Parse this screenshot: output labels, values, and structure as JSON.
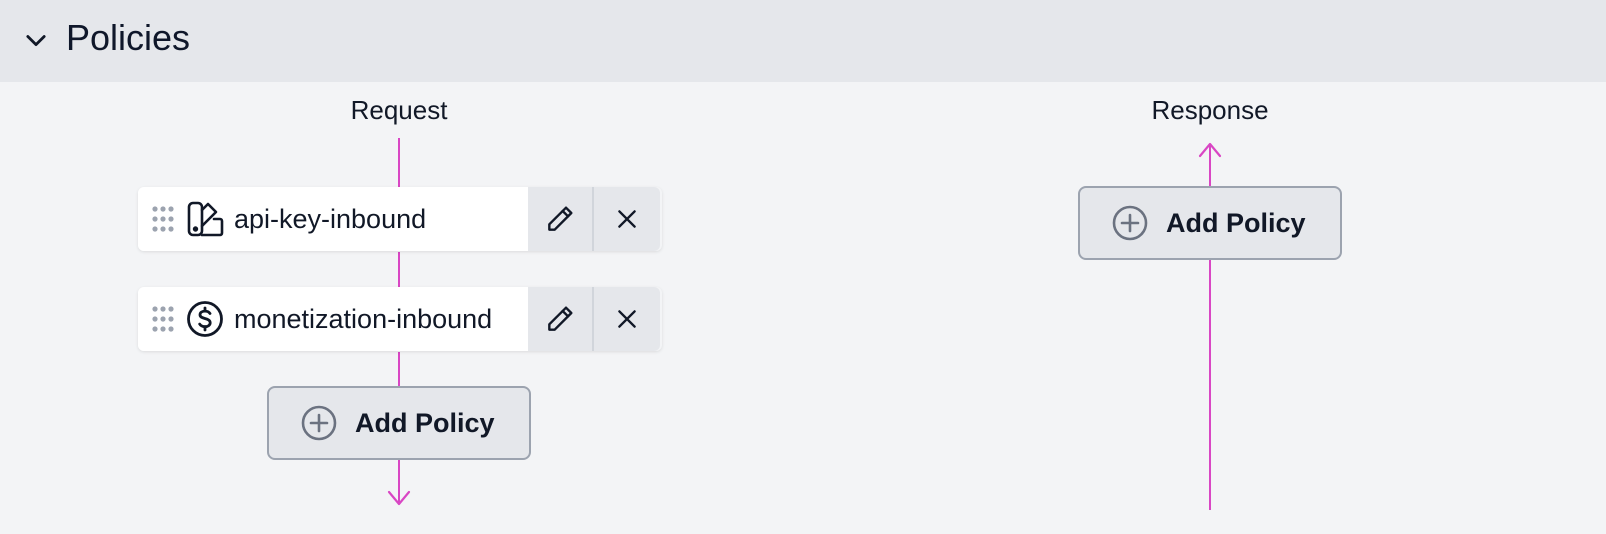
{
  "section": {
    "title": "Policies",
    "toggle_icon": "chevron-down-icon"
  },
  "request": {
    "label": "Request",
    "policies": [
      {
        "name": "api-key-inbound",
        "icon": "api-key-icon"
      },
      {
        "name": "monetization-inbound",
        "icon": "dollar-circle-icon"
      }
    ],
    "add_label": "Add Policy"
  },
  "response": {
    "label": "Response",
    "policies": [],
    "add_label": "Add Policy"
  },
  "colors": {
    "flow_line": "#d946c4",
    "header_bg": "#e5e7eb",
    "page_bg": "#f3f4f6"
  }
}
